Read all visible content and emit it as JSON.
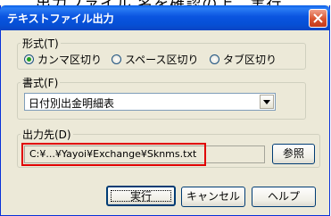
{
  "top_caption": "出力ファイル 名を確認の上、実行",
  "dialog": {
    "title": "テキストファイル出力",
    "format_group": {
      "legend": "形式(T)",
      "options": [
        {
          "label": "カンマ区切り",
          "selected": true
        },
        {
          "label": "スペース区切り",
          "selected": false
        },
        {
          "label": "タブ区切り",
          "selected": false
        }
      ]
    },
    "style_group": {
      "legend": "書式(F)",
      "selected": "日付別出金明細表"
    },
    "output_group": {
      "legend": "出力先(D)",
      "path": "C:¥...¥Yayoi¥Exchange¥Sknms.txt",
      "browse_label": "参照"
    },
    "buttons": {
      "run": "実行",
      "cancel": "キャンセル",
      "help": "ヘルプ"
    }
  },
  "colors": {
    "titlebar": "#0a54e0",
    "close_button": "#d9532f",
    "highlight_border": "#e00000",
    "selected_radio": "#21a121"
  }
}
